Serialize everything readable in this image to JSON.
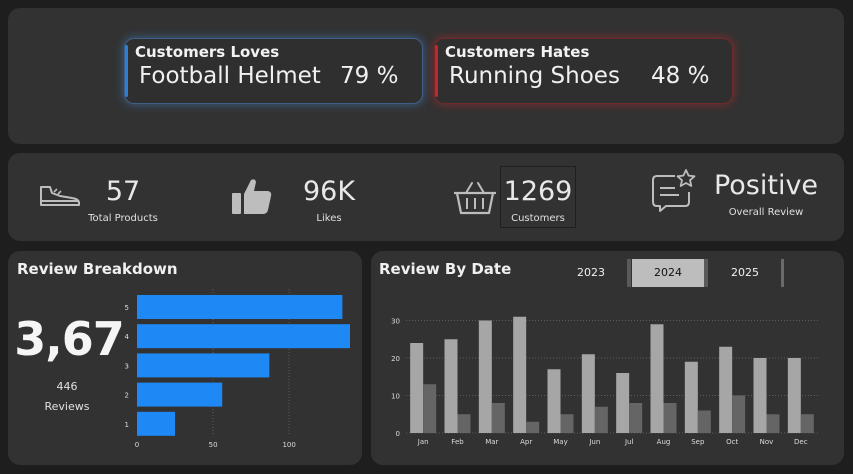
{
  "highlights": {
    "loves": {
      "label": "Customers Loves",
      "product": "Football Helmet",
      "percent": "79 %",
      "accent": "#2d7fd6"
    },
    "hates": {
      "label": "Customers Hates",
      "product": "Running Shoes",
      "percent": "48 %",
      "accent": "#c0282c"
    }
  },
  "kpis": [
    {
      "icon": "sneaker-icon",
      "value": "57",
      "label": "Total Products"
    },
    {
      "icon": "thumbs-up-icon",
      "value": "96K",
      "label": "Likes"
    },
    {
      "icon": "basket-icon",
      "value": "1269",
      "label": "Customers"
    },
    {
      "icon": "review-star-icon",
      "value": "Positive",
      "label": "Overall Review"
    }
  ],
  "breakdown": {
    "title": "Review Breakdown",
    "score": "3,67",
    "count": "446",
    "count_label": "Reviews"
  },
  "by_date": {
    "title": "Review By Date",
    "years": [
      "2023",
      "2024",
      "2025"
    ],
    "selected_year": "2024"
  },
  "chart_data": [
    {
      "type": "bar",
      "orientation": "horizontal",
      "title": "Review Breakdown",
      "categories": [
        "5",
        "4",
        "3",
        "2",
        "1"
      ],
      "values": [
        135,
        140,
        87,
        56,
        25
      ],
      "xlim": [
        0,
        140
      ],
      "xticks": [
        0,
        50,
        100
      ],
      "grid": true,
      "color": "#1e88f5"
    },
    {
      "type": "bar",
      "title": "Review By Date",
      "categories": [
        "Jan",
        "Feb",
        "Mar",
        "Apr",
        "May",
        "Jun",
        "Jul",
        "Aug",
        "Sep",
        "Oct",
        "Nov",
        "Dec"
      ],
      "series": [
        {
          "values": [
            24,
            25,
            30,
            31,
            17,
            21,
            16,
            29,
            19,
            23,
            20,
            20
          ],
          "color": "#a6a6a6"
        },
        {
          "values": [
            13,
            5,
            8,
            3,
            5,
            7,
            8,
            8,
            6,
            10,
            5,
            5
          ],
          "color": "#656565"
        }
      ],
      "ylim": [
        0,
        32
      ],
      "yticks": [
        0,
        10,
        20,
        30
      ],
      "grid": true
    }
  ]
}
